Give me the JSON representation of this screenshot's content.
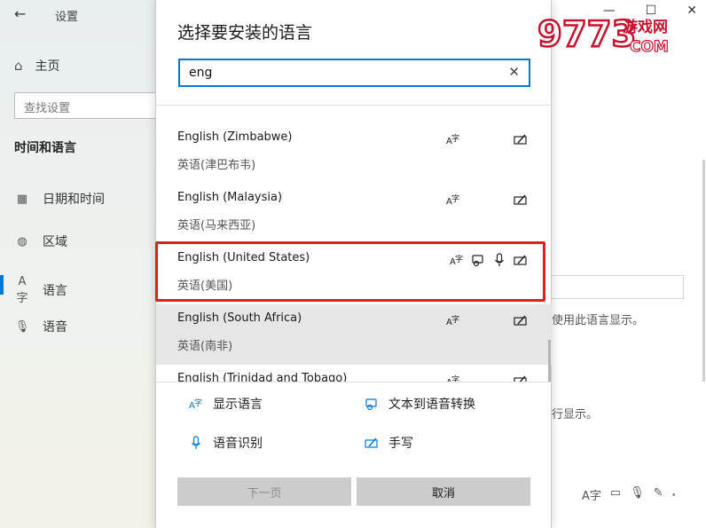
{
  "settings_window": {
    "title": "设置",
    "back_glyph": "←",
    "home_label": "主页",
    "search_placeholder": "查找设置",
    "section": "时间和语言",
    "nav_items": [
      {
        "label": "日期和时间",
        "icon": "calendar-clock-icon"
      },
      {
        "label": "区域",
        "icon": "globe-icon"
      },
      {
        "label": "语言",
        "icon": "language-icon"
      },
      {
        "label": "语音",
        "icon": "microphone-icon"
      }
    ],
    "controls": [
      "—",
      "☐",
      "✕"
    ],
    "partial_text_1": "使用此语言显示。",
    "partial_text_2": "行显示。"
  },
  "dialog": {
    "title": "选择要安装的语言",
    "search_value": "eng",
    "clear_glyph": "✕",
    "languages": [
      {
        "name": "English (Zimbabwe)",
        "native": "英语(津巴布韦)",
        "features": [
          "display",
          "handwriting"
        ]
      },
      {
        "name": "English (Malaysia)",
        "native": "英语(马来西亚)",
        "features": [
          "display",
          "handwriting"
        ]
      },
      {
        "name": "English (United States)",
        "native": "英语(美国)",
        "features": [
          "display",
          "tts",
          "speech",
          "handwriting"
        ]
      },
      {
        "name": "English (South Africa)",
        "native": "英语(南非)",
        "features": [
          "display",
          "handwriting"
        ]
      },
      {
        "name": "English (Trinidad and Tobago)",
        "native": "",
        "features": [
          "display",
          "handwriting"
        ]
      }
    ],
    "legend": {
      "display": "显示语言",
      "tts": "文本到语音转换",
      "speech": "语音识别",
      "handwriting": "手写"
    },
    "buttons": {
      "next": "下一页",
      "cancel": "取消"
    }
  },
  "watermark": {
    "digits": "9773",
    "site": "游戏网",
    "domain": "COM"
  },
  "colors": {
    "accent": "#0078d7",
    "highlight": "#e02020",
    "button_bg": "#cccccc"
  }
}
